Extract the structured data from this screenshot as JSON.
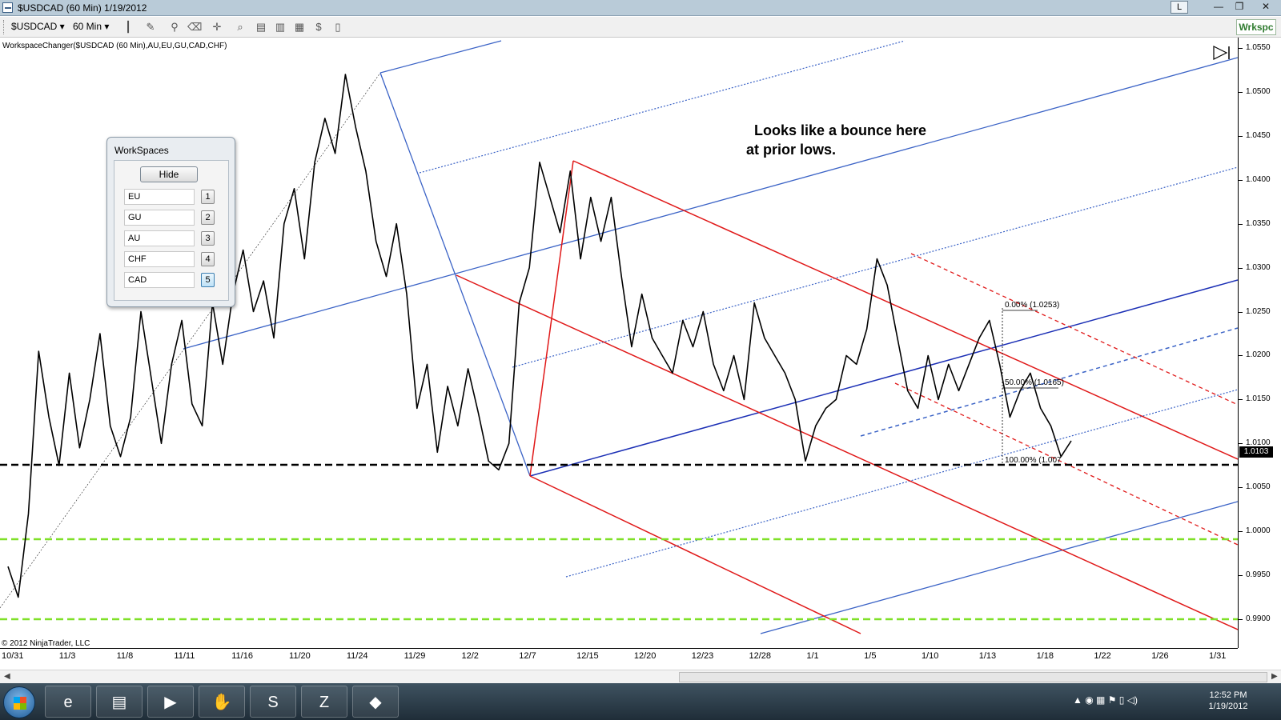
{
  "window": {
    "title": "$USDCAD (60 Min)  1/19/2012",
    "link_button": "L",
    "min_glyph": "—",
    "max_glyph": "❐",
    "close_glyph": "✕"
  },
  "toolbar": {
    "instrument": "$USDCAD ▾",
    "interval": "60 Min ▾",
    "workspace_button": "Wrkspc"
  },
  "indicator_label": "WorkspaceChanger($USDCAD (60 Min),AU,EU,GU,CAD,CHF)",
  "annotation": "  Looks like a bounce here\nat prior lows.",
  "copyright": "© 2012 NinjaTrader, LLC",
  "fib_labels": {
    "level_0": "0.00% (1.0253)",
    "level_50": "50.00% (1.0165)",
    "level_100": "100.00% (1.007"
  },
  "last_price": "1.0103",
  "workspaces_panel": {
    "title": "WorkSpaces",
    "hide_label": "Hide",
    "rows": [
      {
        "name": "EU",
        "num": "1"
      },
      {
        "name": "GU",
        "num": "2"
      },
      {
        "name": "AU",
        "num": "3"
      },
      {
        "name": "CHF",
        "num": "4"
      },
      {
        "name": "CAD",
        "num": "5"
      }
    ]
  },
  "chart_data": {
    "type": "line",
    "title": "$USDCAD (60 Min)",
    "y_ticks": [
      "1.0550",
      "1.0500",
      "1.0450",
      "1.0400",
      "1.0350",
      "1.0300",
      "1.0250",
      "1.0200",
      "1.0150",
      "1.0100",
      "1.0050",
      "1.0000",
      "0.9950",
      "0.9900"
    ],
    "x_ticks": [
      "10/31",
      "11/3",
      "11/8",
      "11/11",
      "11/16",
      "11/20",
      "11/24",
      "11/29",
      "12/2",
      "12/7",
      "12/15",
      "12/20",
      "12/23",
      "12/28",
      "1/1",
      "1/5",
      "1/10",
      "1/13",
      "1/18",
      "1/22",
      "1/26",
      "1/31"
    ],
    "ylim": [
      0.989,
      1.056
    ],
    "series": [
      {
        "values": [
          0.996,
          0.9925,
          1.002,
          1.0205,
          1.013,
          1.0075,
          1.018,
          1.0095,
          1.015,
          1.0225,
          1.012,
          1.0085,
          1.013,
          1.025,
          1.0175,
          1.01,
          1.019,
          1.024,
          1.0145,
          1.012,
          1.026,
          1.019,
          1.027,
          1.032,
          1.025,
          1.0285,
          1.022,
          1.035,
          1.039,
          1.031,
          1.042,
          1.047,
          1.043,
          1.052,
          1.046,
          1.041,
          1.033,
          1.029,
          1.035,
          1.027,
          1.014,
          1.019,
          1.009,
          1.0165,
          1.012,
          1.0185,
          1.0135,
          1.008,
          1.007,
          1.01,
          1.026,
          1.03,
          1.042,
          1.038,
          1.034,
          1.041,
          1.031,
          1.038,
          1.033,
          1.038,
          1.029,
          1.021,
          1.027,
          1.022,
          1.02,
          1.018,
          1.024,
          1.021,
          1.025,
          1.019,
          1.016,
          1.02,
          1.015,
          1.026,
          1.022,
          1.02,
          1.018,
          1.015,
          1.008,
          1.012,
          1.014,
          1.015,
          1.02,
          1.019,
          1.023,
          1.031,
          1.028,
          1.022,
          1.016,
          1.014,
          1.02,
          1.015,
          1.019,
          1.016,
          1.019,
          1.022,
          1.024,
          1.019,
          1.013,
          1.016,
          1.018,
          1.014,
          1.012,
          1.0085,
          1.0103
        ]
      }
    ]
  },
  "taskbar": {
    "apps": [
      "e",
      "▤",
      "▶",
      "✋",
      "S",
      "Z",
      "◆"
    ],
    "clock_time": "12:52 PM",
    "clock_date": "1/19/2012",
    "tray": "▲ ◉ ▦ ⚑ ▯ ◁)"
  }
}
